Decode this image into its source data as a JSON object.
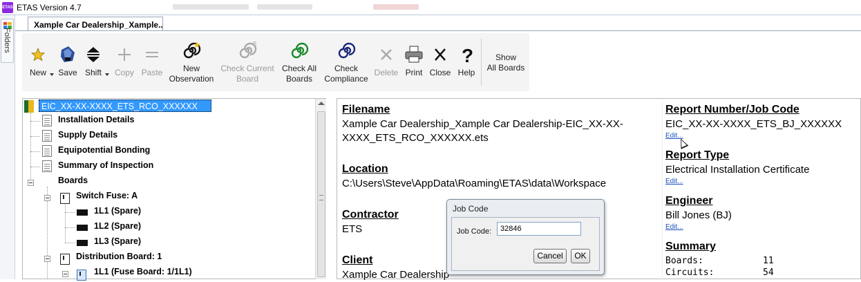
{
  "window": {
    "title": "ETAS Version 4.7",
    "app_icon_text": "ETAS"
  },
  "left_strip": {
    "folders_label": "Folders"
  },
  "document_tab": {
    "label": "Xample Car Dealership_Xample..."
  },
  "toolbar": {
    "new": "New",
    "save": "Save",
    "shift": "Shift",
    "copy": "Copy",
    "paste": "Paste",
    "new_observation": [
      "New",
      "Observation"
    ],
    "check_current_board": [
      "Check Current",
      "Board"
    ],
    "check_all_boards": [
      "Check All",
      "Boards"
    ],
    "check_compliance": [
      "Check",
      "Compliance"
    ],
    "delete": "Delete",
    "print": "Print",
    "close": "Close",
    "help": "Help",
    "show_all_boards": [
      "Show",
      "All Boards"
    ]
  },
  "tree": {
    "root": "EIC_XX-XX-XXXX_ETS_RCO_XXXXXX",
    "items": [
      "Installation Details",
      "Supply Details",
      "Equipotential Bonding",
      "Summary of Inspection",
      "Boards"
    ],
    "boards": [
      {
        "label": "Switch Fuse: A",
        "children": [
          "1L1 (Spare)",
          "1L2 (Spare)",
          "1L3 (Spare)"
        ]
      },
      {
        "label": "Distribution Board: 1",
        "children": [
          "1L1 (Fuse Board: 1/1L1)"
        ]
      }
    ]
  },
  "details": {
    "filename": {
      "head": "Filename",
      "lines": [
        "Xample Car Dealership_Xample Car Dealership-EIC_XX-XX-",
        "XXXX_ETS_RCO_XXXXXX.ets"
      ]
    },
    "location": {
      "head": "Location",
      "value": "C:\\Users\\Steve\\AppData\\Roaming\\ETAS\\data\\Workspace"
    },
    "contractor": {
      "head": "Contractor",
      "value": "ETS"
    },
    "client": {
      "head": "Client",
      "value": "Xample Car Dealership"
    },
    "report_number": {
      "head": "Report Number/Job Code",
      "value": "EIC_XX-XX-XXXX_ETS_BJ_XXXXXX",
      "edit": "Edit..."
    },
    "report_type": {
      "head": "Report Type",
      "value": "Electrical Installation Certificate",
      "edit": "Edit..."
    },
    "engineer": {
      "head": "Engineer",
      "value": "Bill Jones (BJ)",
      "edit": "Edit..."
    },
    "summary": {
      "head": "Summary",
      "boards_label": "Boards:",
      "boards_value": "11",
      "circuits_label": "Circuits:",
      "circuits_value": "54"
    }
  },
  "dialog": {
    "title": "Job Code",
    "label": "Job Code:",
    "value": "32846",
    "cancel": "Cancel",
    "ok": "OK"
  },
  "colors": {
    "selection": "#3399ff",
    "link": "#1a4fbf",
    "star": "#f0c020",
    "spiral_green": "#1a8a2a",
    "spiral_navy": "#1c2a7a"
  }
}
